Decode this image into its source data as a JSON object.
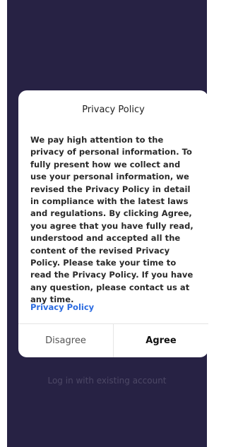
{
  "background": {
    "login_link": "Log in with existing account"
  },
  "dialog": {
    "title": "Privacy Policy",
    "body": "We pay high attention to the privacy of personal information. To fully present how we collect and use your personal information, we revised the Privacy Policy in detail in compliance with the latest laws and regulations. By clicking Agree, you agree that you have fully read, understood and accepted all the content of the revised Privacy Policy. Please take your time to read the Privacy Policy. If you have any question, please contact us at any time.",
    "link": "Privacy Policy",
    "disagree_label": "Disagree",
    "agree_label": "Agree"
  },
  "colors": {
    "background": "#272244",
    "link": "#2b6be0"
  }
}
